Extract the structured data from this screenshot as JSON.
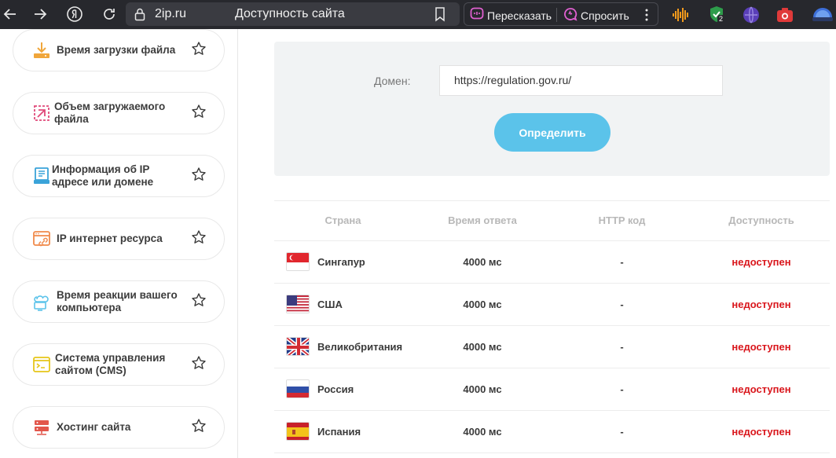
{
  "browser": {
    "domain": "2ip.ru",
    "page_title": "Доступность сайта",
    "retell_label": "Пересказать",
    "ask_label": "Спросить",
    "icons": [
      "back-icon",
      "forward-icon",
      "yandex-icon",
      "reload-icon",
      "lock-icon",
      "bookmark-icon",
      "more-icon"
    ],
    "extension_badge": "2"
  },
  "sidebar": {
    "items": [
      {
        "label": "Время загрузки файла",
        "icon": "download-icon",
        "color": "#f0a63b"
      },
      {
        "label": "Объем загружаемого файла",
        "icon": "resize-icon",
        "color": "#e04a7a"
      },
      {
        "label": "Информация об IP адресе или домене",
        "icon": "document-icon",
        "color": "#3aa3d9"
      },
      {
        "label": "IP интернет ресурса",
        "icon": "browser-link-icon",
        "color": "#f08a4b"
      },
      {
        "label": "Время реакции вашего компьютера",
        "icon": "cloud-computer-icon",
        "color": "#5bc3ea"
      },
      {
        "label": "Система управления сайтом (CMS)",
        "icon": "terminal-icon",
        "color": "#e6c619"
      },
      {
        "label": "Хостинг сайта",
        "icon": "server-icon",
        "color": "#e2574c"
      }
    ]
  },
  "form": {
    "domain_label": "Домен:",
    "domain_value": "https://regulation.gov.ru/",
    "submit_label": "Определить"
  },
  "table": {
    "headers": [
      "Страна",
      "Время ответа",
      "HTTP код",
      "Доступность"
    ],
    "rows": [
      {
        "country": "Сингапур",
        "flag": "sg",
        "response_time": "4000 мс",
        "http_code": "-",
        "availability": "недоступен"
      },
      {
        "country": "США",
        "flag": "us",
        "response_time": "4000 мс",
        "http_code": "-",
        "availability": "недоступен"
      },
      {
        "country": "Великобритания",
        "flag": "gb",
        "response_time": "4000 мс",
        "http_code": "-",
        "availability": "недоступен"
      },
      {
        "country": "Россия",
        "flag": "ru",
        "response_time": "4000 мс",
        "http_code": "-",
        "availability": "недоступен"
      },
      {
        "country": "Испания",
        "flag": "es",
        "response_time": "4000 мс",
        "http_code": "-",
        "availability": "недоступен"
      }
    ]
  },
  "colors": {
    "accent": "#5bc3ea",
    "unavailable": "#d9151b",
    "toolbar_bg": "#27282d"
  }
}
